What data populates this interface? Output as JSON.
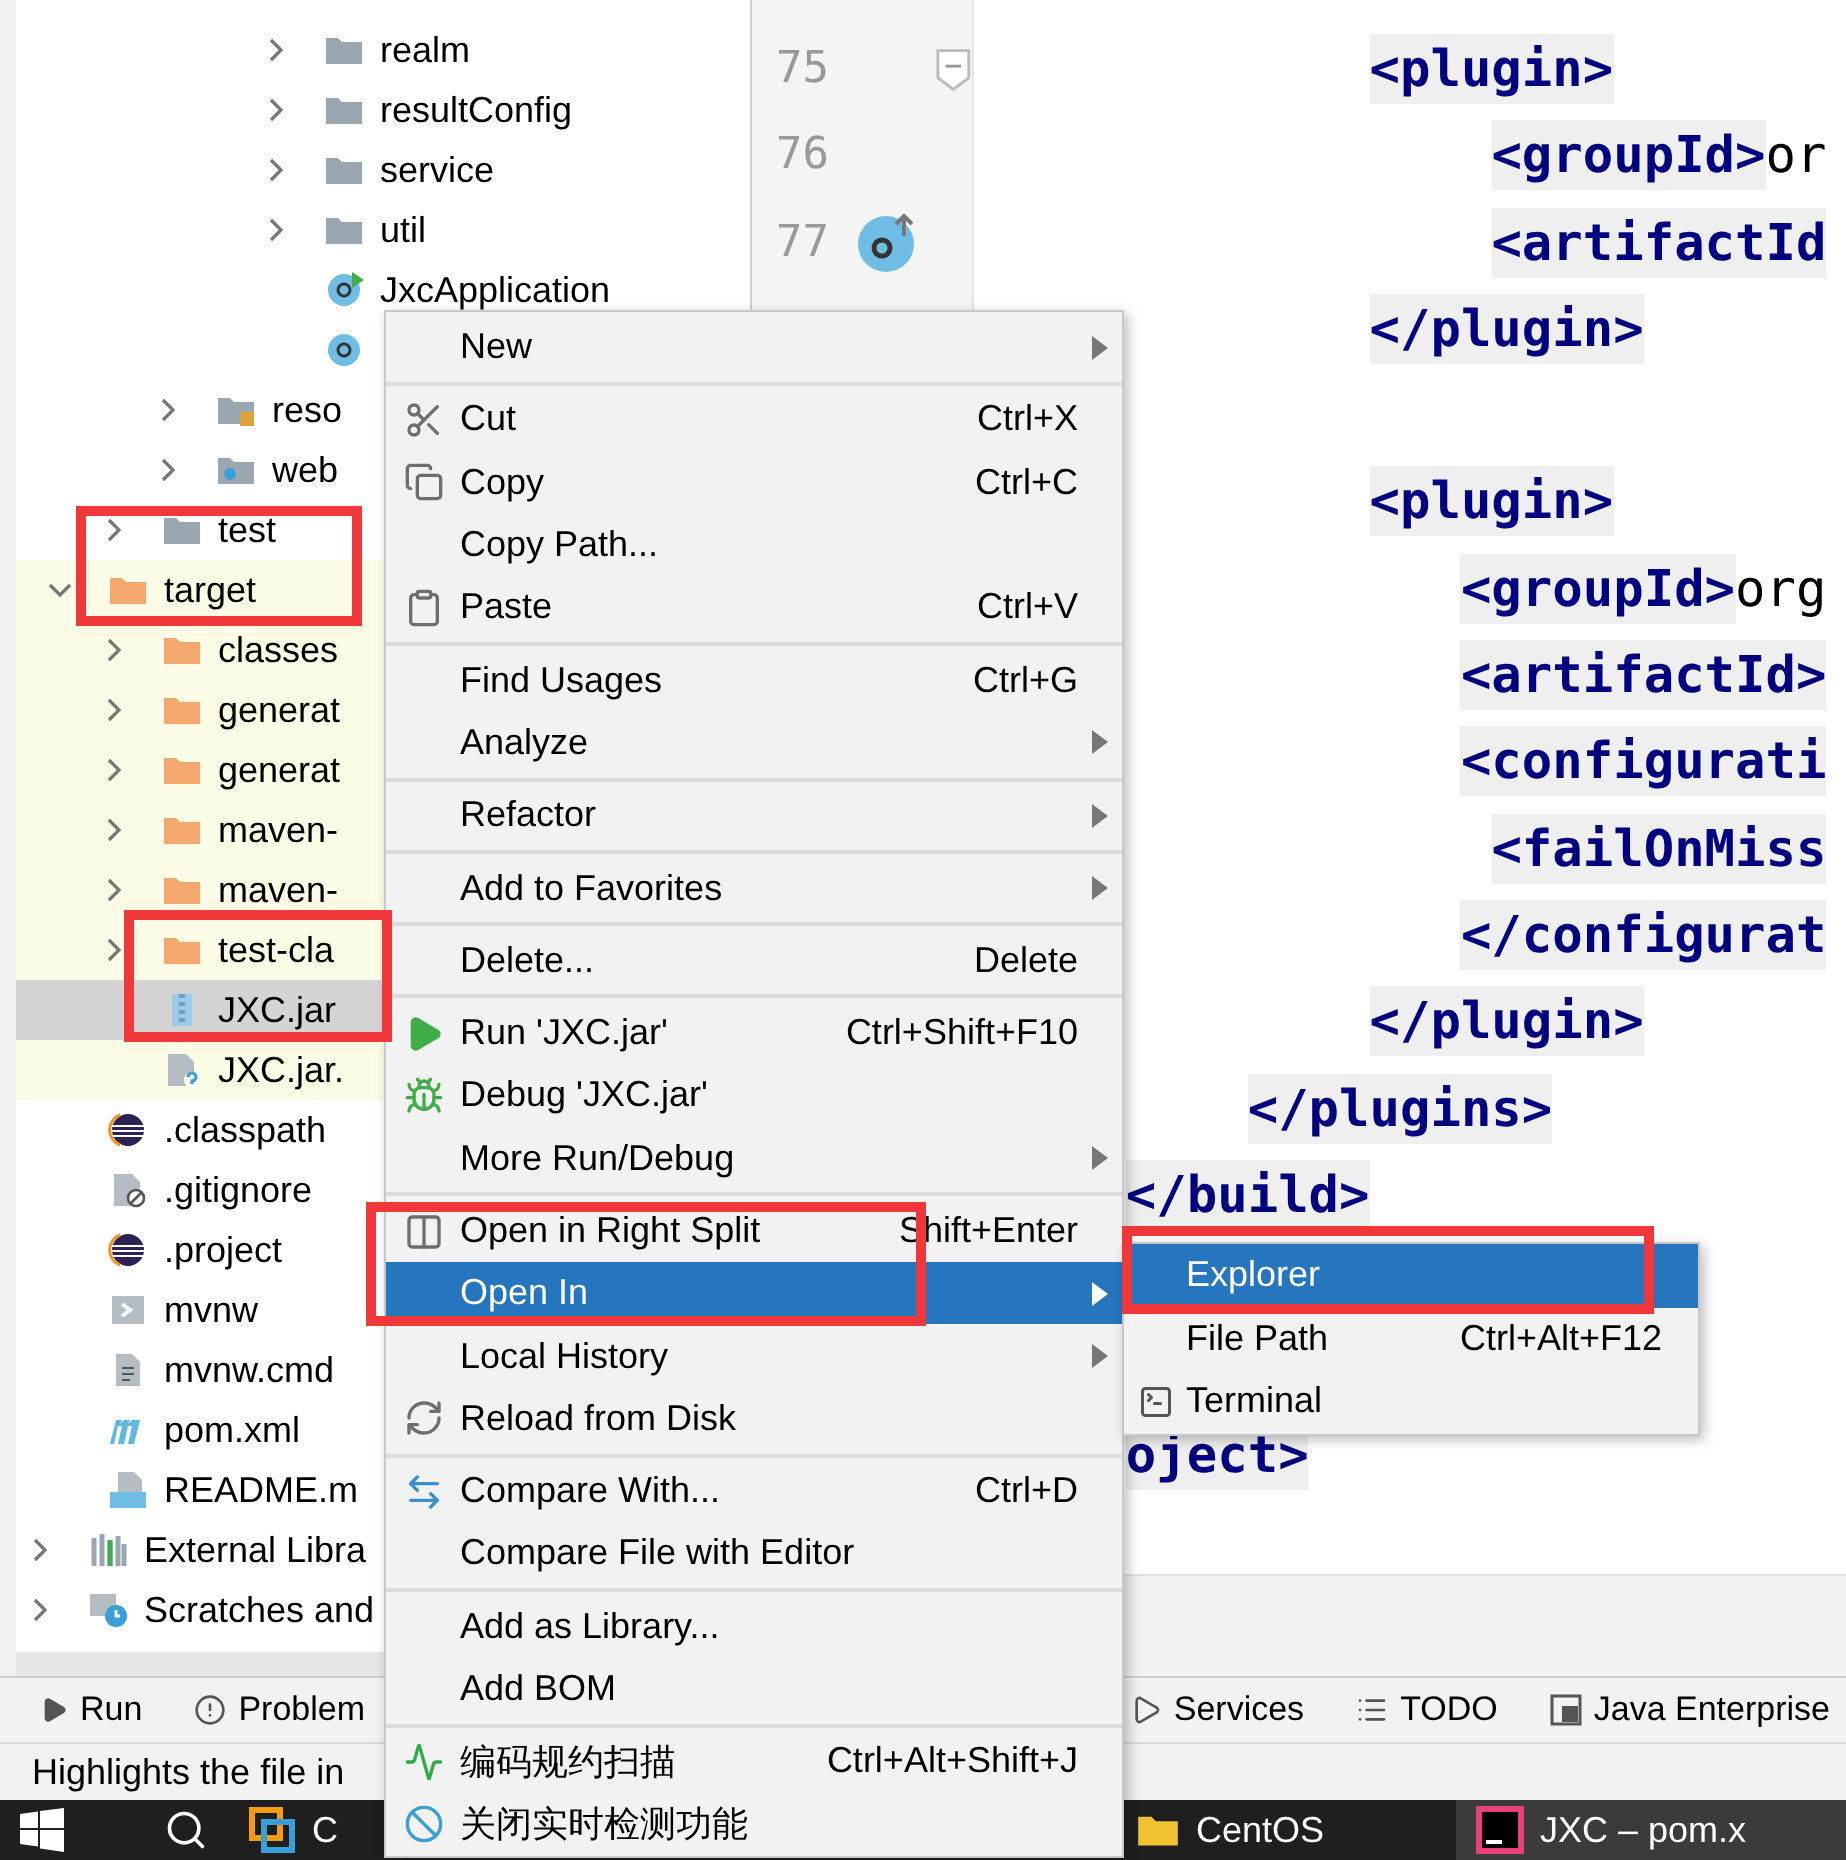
{
  "tree": [
    {
      "children": [
        {
          "children": [
            {
              "children": [
                {
                  "children": [
                    {
                      "children": [
                        {
                          "label": "realm",
                          "kind": "folder",
                          "expanded": false,
                          "selected": false
                        },
                        {
                          "label": "resultConfig",
                          "kind": "folder",
                          "expanded": false,
                          "selected": false
                        },
                        {
                          "label": "service",
                          "kind": "folder",
                          "expanded": false,
                          "selected": false
                        },
                        {
                          "label": "util",
                          "kind": "folder",
                          "expanded": false,
                          "selected": false
                        },
                        {
                          "label": "JxcApplication",
                          "kind": "app-class",
                          "selected": false
                        },
                        {
                          "kind": "class",
                          "selected": false
                        }
                      ]
                    }
                  ]
                },
                {
                  "label": "reso",
                  "kind": "resources-folder",
                  "expanded": false,
                  "selected": false
                },
                {
                  "label": "web",
                  "kind": "web-folder",
                  "expanded": false,
                  "selected": false
                }
              ]
            },
            {
              "label": "test",
              "kind": "folder",
              "expanded": false,
              "selected": false
            }
          ]
        },
        {
          "label": "target",
          "kind": "orange-folder",
          "expanded": true,
          "excluded": true,
          "selected": false,
          "children": [
            {
              "label": "classes",
              "kind": "orange-folder",
              "expanded": false,
              "selected": false
            },
            {
              "label": "generat",
              "kind": "orange-folder",
              "expanded": false,
              "selected": false
            },
            {
              "label": "generat",
              "kind": "orange-folder",
              "expanded": false,
              "selected": false
            },
            {
              "label": "maven-",
              "kind": "orange-folder",
              "expanded": false,
              "selected": false
            },
            {
              "label": "maven-",
              "kind": "orange-folder",
              "expanded": false,
              "selected": false
            },
            {
              "label": "test-cla",
              "kind": "orange-folder",
              "expanded": false,
              "selected": false
            },
            {
              "label": "JXC.jar",
              "kind": "jar",
              "selected": true
            },
            {
              "label": "JXC.jar.",
              "kind": "unknown-file",
              "selected": false
            }
          ]
        },
        {
          "label": ".classpath",
          "kind": "eclipse",
          "selected": false
        },
        {
          "label": ".gitignore",
          "kind": "ignore-file",
          "selected": false
        },
        {
          "label": ".project",
          "kind": "eclipse",
          "selected": false
        },
        {
          "label": "mvnw",
          "kind": "script",
          "selected": false
        },
        {
          "label": "mvnw.cmd",
          "kind": "text-file",
          "selected": false
        },
        {
          "label": "pom.xml",
          "kind": "maven",
          "selected": false
        },
        {
          "label": "README.m",
          "kind": "markdown",
          "selected": false
        }
      ]
    },
    {
      "label": "External Libra",
      "kind": "libraries",
      "expanded": false,
      "selected": false
    },
    {
      "label": "Scratches and",
      "kind": "scratches",
      "expanded": false,
      "selected": false
    }
  ],
  "gutter": [
    {
      "number": "75",
      "fold": true
    },
    {
      "number": "76"
    },
    {
      "number": "77",
      "override": true
    }
  ],
  "code_lines": [
    {
      "kind": "tag",
      "tag": "            <plugin>"
    },
    {
      "kind": "tag",
      "tag": "                <groupId>",
      "text": "or"
    },
    {
      "kind": "tag",
      "tag": "                <artifactId"
    },
    {
      "kind": "tag",
      "tag": "            </plugin>"
    },
    {
      "kind": "blank"
    },
    {
      "kind": "tag",
      "tag": "            <plugin>"
    },
    {
      "kind": "tag",
      "tag": "               <groupId>",
      "text": "org"
    },
    {
      "kind": "tag",
      "tag": "               <artifactId>"
    },
    {
      "kind": "tag",
      "tag": "               <configurati"
    },
    {
      "kind": "tag",
      "tag": "                <failOnMiss"
    },
    {
      "kind": "tag",
      "tag": "               </configurat"
    },
    {
      "kind": "tag",
      "tag": "            </plugin>"
    },
    {
      "kind": "tag",
      "tag": "        </plugins>"
    },
    {
      "kind": "tag",
      "tag": "    </build>"
    },
    {
      "kind": "blank"
    },
    {
      "kind": "blank"
    },
    {
      "kind": "tag",
      "tag": "    oject>"
    }
  ],
  "context_menu": [
    {
      "kind": "plain",
      "label": "New",
      "submenu": true,
      "selected": false
    },
    {
      "kind": "separator"
    },
    {
      "kind": "scissors",
      "label": "Cut",
      "shortcut": "Ctrl+X",
      "selected": false
    },
    {
      "kind": "copy",
      "label": "Copy",
      "shortcut": "Ctrl+C",
      "selected": false
    },
    {
      "kind": "plain",
      "label": "Copy Path...",
      "selected": false
    },
    {
      "kind": "clipboard",
      "label": "Paste",
      "shortcut": "Ctrl+V",
      "selected": false
    },
    {
      "kind": "separator"
    },
    {
      "kind": "plain",
      "label": "Find Usages",
      "shortcut": "Ctrl+G",
      "selected": false
    },
    {
      "kind": "plain",
      "label": "Analyze",
      "submenu": true,
      "selected": false
    },
    {
      "kind": "separator"
    },
    {
      "kind": "plain",
      "label": "Refactor",
      "submenu": true,
      "selected": false
    },
    {
      "kind": "separator"
    },
    {
      "kind": "plain",
      "label": "Add to Favorites",
      "submenu": true,
      "selected": false
    },
    {
      "kind": "separator"
    },
    {
      "kind": "plain",
      "label": "Delete...",
      "shortcut": "Delete",
      "selected": false
    },
    {
      "kind": "separator"
    },
    {
      "kind": "play",
      "label": "Run 'JXC.jar'",
      "shortcut": "Ctrl+Shift+F10",
      "selected": false
    },
    {
      "kind": "bug",
      "label": "Debug 'JXC.jar'",
      "selected": false
    },
    {
      "kind": "plain",
      "label": "More Run/Debug",
      "submenu": true,
      "selected": false
    },
    {
      "kind": "separator"
    },
    {
      "kind": "split",
      "label": "Open in Right Split",
      "shortcut": "Shift+Enter",
      "selected": false
    },
    {
      "kind": "plain",
      "label": "Open In",
      "submenu": true,
      "selected": true
    },
    {
      "kind": "plain",
      "label": "Local History",
      "submenu": true,
      "selected": false
    },
    {
      "kind": "reload",
      "label": "Reload from Disk",
      "selected": false
    },
    {
      "kind": "separator"
    },
    {
      "kind": "compare",
      "label": "Compare With...",
      "shortcut": "Ctrl+D",
      "selected": false
    },
    {
      "kind": "plain",
      "label": "Compare File with Editor",
      "selected": false
    },
    {
      "kind": "separator"
    },
    {
      "kind": "plain",
      "label": "Add as Library...",
      "selected": false
    },
    {
      "kind": "plain",
      "label": "Add BOM",
      "selected": false
    },
    {
      "kind": "separator"
    },
    {
      "kind": "pulse",
      "label": "编码规约扫描",
      "shortcut": "Ctrl+Alt+Shift+J",
      "selected": false
    },
    {
      "kind": "ban",
      "label": "关闭实时检测功能",
      "selected": false
    }
  ],
  "submenu": [
    {
      "kind": "plain",
      "label": "Explorer",
      "selected": true
    },
    {
      "kind": "plain",
      "label": "File Path",
      "shortcut": "Ctrl+Alt+F12",
      "selected": false
    },
    {
      "kind": "terminal",
      "label": "Terminal",
      "selected": false
    }
  ],
  "tool_windows": [
    {
      "label": "Run",
      "kind": "run"
    },
    {
      "label": "Problem",
      "kind": "problems"
    },
    {
      "label": "Services",
      "kind": "services"
    },
    {
      "label": "TODO",
      "kind": "todo"
    },
    {
      "label": "Java Enterprise",
      "kind": "enterprise"
    }
  ],
  "status_bar": {
    "message": "Highlights the file in"
  },
  "taskbar": [
    {
      "kind": "start"
    },
    {
      "kind": "search"
    },
    {
      "kind": "vm",
      "label": "C",
      "selected": false
    },
    {
      "kind": "folder",
      "label": "CentOS",
      "selected": false
    },
    {
      "kind": "ide",
      "label": "JXC – pom.x",
      "selected": true
    }
  ]
}
